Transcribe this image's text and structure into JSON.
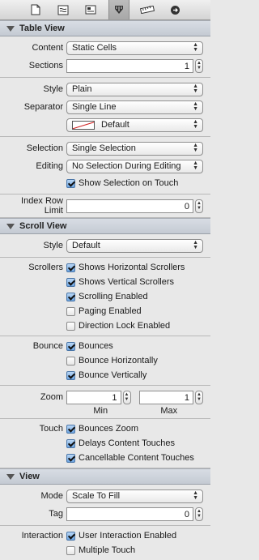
{
  "toolbar": {
    "icons": [
      "file-icon",
      "quick-help-icon",
      "identity-icon",
      "attributes-icon",
      "size-icon",
      "connections-icon"
    ],
    "active": "attributes-icon"
  },
  "table_view": {
    "title": "Table View",
    "content_label": "Content",
    "content_value": "Static Cells",
    "sections_label": "Sections",
    "sections_value": "1",
    "style_label": "Style",
    "style_value": "Plain",
    "separator_label": "Separator",
    "separator_value": "Single Line",
    "separator_color": "Default",
    "selection_label": "Selection",
    "selection_value": "Single Selection",
    "editing_label": "Editing",
    "editing_value": "No Selection During Editing",
    "show_selection": {
      "label": "Show Selection on Touch",
      "checked": true
    },
    "index_row_limit_label": "Index Row Limit",
    "index_row_limit_value": "0"
  },
  "scroll_view": {
    "title": "Scroll View",
    "style_label": "Style",
    "style_value": "Default",
    "scrollers_label": "Scrollers",
    "scrollers": [
      {
        "label": "Shows Horizontal Scrollers",
        "checked": true
      },
      {
        "label": "Shows Vertical Scrollers",
        "checked": true
      },
      {
        "label": "Scrolling Enabled",
        "checked": true
      },
      {
        "label": "Paging Enabled",
        "checked": false
      },
      {
        "label": "Direction Lock Enabled",
        "checked": false
      }
    ],
    "bounce_label": "Bounce",
    "bounce": [
      {
        "label": "Bounces",
        "checked": true
      },
      {
        "label": "Bounce Horizontally",
        "checked": false
      },
      {
        "label": "Bounce Vertically",
        "checked": true
      }
    ],
    "zoom_label": "Zoom",
    "zoom_min": "1",
    "zoom_max": "1",
    "zoom_min_label": "Min",
    "zoom_max_label": "Max",
    "touch_label": "Touch",
    "touch": [
      {
        "label": "Bounces Zoom",
        "checked": true
      },
      {
        "label": "Delays Content Touches",
        "checked": true
      },
      {
        "label": "Cancellable Content Touches",
        "checked": true
      }
    ]
  },
  "view": {
    "title": "View",
    "mode_label": "Mode",
    "mode_value": "Scale To Fill",
    "tag_label": "Tag",
    "tag_value": "0",
    "interaction_label": "Interaction",
    "interaction": [
      {
        "label": "User Interaction Enabled",
        "checked": true
      },
      {
        "label": "Multiple Touch",
        "checked": false
      }
    ]
  }
}
